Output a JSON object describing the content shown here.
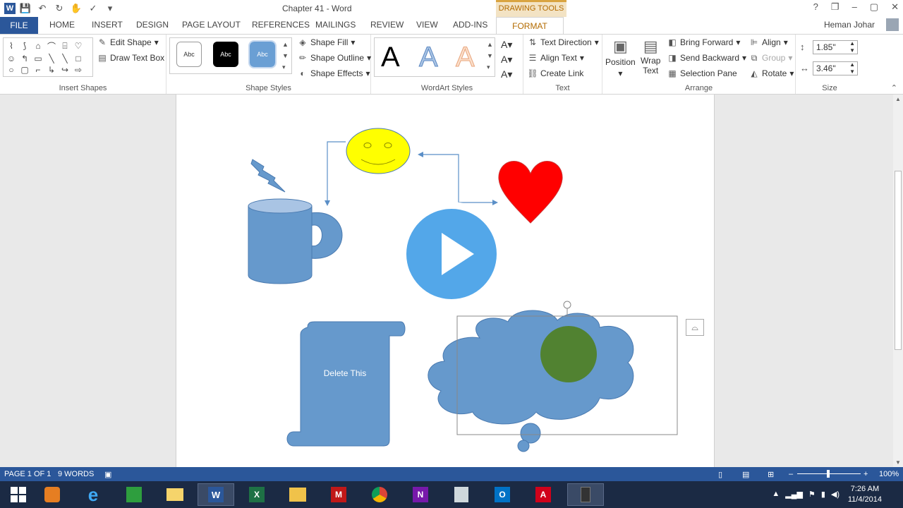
{
  "window": {
    "title": "Chapter 41 - Word",
    "context_label": "DRAWING TOOLS",
    "controls": [
      "?",
      "❐",
      "–",
      "▢",
      "✕"
    ]
  },
  "tabs": {
    "file": "FILE",
    "items": [
      "HOME",
      "INSERT",
      "DESIGN",
      "PAGE LAYOUT",
      "REFERENCES",
      "MAILINGS",
      "REVIEW",
      "VIEW",
      "ADD-INS"
    ],
    "format": "FORMAT",
    "user": "Heman Johar"
  },
  "ribbon": {
    "insert_shapes": {
      "label": "Insert Shapes",
      "edit_shape": "Edit Shape",
      "draw_text_box": "Draw Text Box"
    },
    "shape_styles": {
      "label": "Shape Styles",
      "samples": [
        "Abc",
        "Abc",
        "Abc"
      ],
      "shape_fill": "Shape Fill",
      "shape_outline": "Shape Outline",
      "shape_effects": "Shape Effects"
    },
    "wordart": {
      "label": "WordArt Styles",
      "samples": [
        "A",
        "A",
        "A"
      ]
    },
    "text": {
      "label": "Text",
      "text_direction": "Text Direction",
      "align_text": "Align Text",
      "create_link": "Create Link"
    },
    "arrange": {
      "label": "Arrange",
      "position": "Position",
      "wrap_text_1": "Wrap",
      "wrap_text_2": "Text",
      "bring_forward": "Bring Forward",
      "send_backward": "Send Backward",
      "selection_pane": "Selection Pane",
      "align": "Align",
      "group": "Group",
      "rotate": "Rotate"
    },
    "size": {
      "label": "Size",
      "height": "1.85\"",
      "width": "3.46\""
    }
  },
  "document": {
    "scroll_text": "Delete This"
  },
  "status": {
    "page": "PAGE 1 OF 1",
    "words": "9 WORDS",
    "zoom": "100%"
  },
  "taskbar": {
    "time": "7:26 AM",
    "date": "11/4/2014"
  },
  "colors": {
    "accent": "#2b579a",
    "shape_blue": "#6699cc",
    "heart": "#ff0000",
    "smiley": "#ffff00",
    "format_tab": "#b36b00"
  }
}
